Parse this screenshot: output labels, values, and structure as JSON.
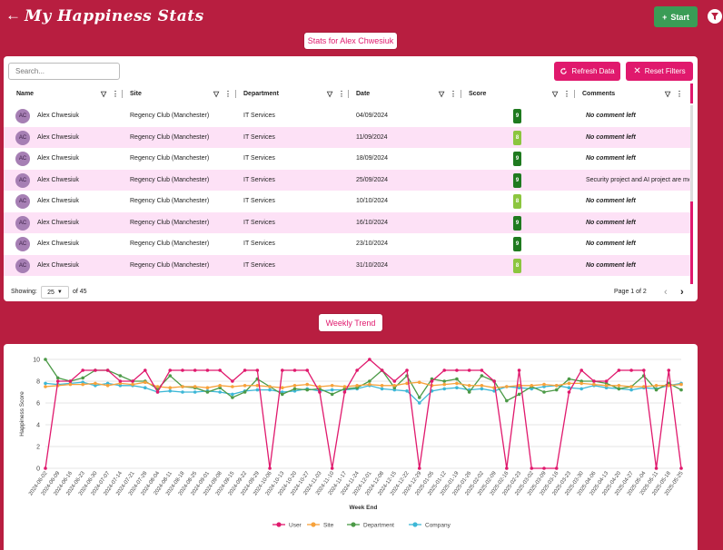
{
  "app": {
    "title": "My Happiness Stats",
    "back_icon": "arrow-left-icon"
  },
  "start_button": {
    "label": "Start",
    "icon": "plus-icon",
    "color": "#3a9c56"
  },
  "filter_button": {
    "icon": "funnel-icon"
  },
  "stats_pill": {
    "label": "Stats for Alex Chwesiuk"
  },
  "search": {
    "placeholder": "Search...",
    "value": ""
  },
  "buttons": {
    "refresh": "Refresh Data",
    "reset": "Reset Filters",
    "accent": "#e0196d"
  },
  "table": {
    "columns": [
      "Name",
      "Site",
      "Department",
      "Date",
      "Score",
      "Comments"
    ],
    "rows": [
      {
        "initials": "AC",
        "name": "Alex Chwesiuk",
        "site": "Regency Club (Manchester)",
        "department": "IT Services",
        "date": "04/09/2024",
        "score": "9",
        "comment": "No comment left"
      },
      {
        "initials": "AC",
        "name": "Alex Chwesiuk",
        "site": "Regency Club (Manchester)",
        "department": "IT Services",
        "date": "11/09/2024",
        "score": "8",
        "comment": "No comment left"
      },
      {
        "initials": "AC",
        "name": "Alex Chwesiuk",
        "site": "Regency Club (Manchester)",
        "department": "IT Services",
        "date": "18/09/2024",
        "score": "9",
        "comment": "No comment left"
      },
      {
        "initials": "AC",
        "name": "Alex Chwesiuk",
        "site": "Regency Club (Manchester)",
        "department": "IT Services",
        "date": "25/09/2024",
        "score": "9",
        "comment": "Security project and AI project are mo"
      },
      {
        "initials": "AC",
        "name": "Alex Chwesiuk",
        "site": "Regency Club (Manchester)",
        "department": "IT Services",
        "date": "10/10/2024",
        "score": "8",
        "comment": "No comment left"
      },
      {
        "initials": "AC",
        "name": "Alex Chwesiuk",
        "site": "Regency Club (Manchester)",
        "department": "IT Services",
        "date": "16/10/2024",
        "score": "9",
        "comment": "No comment left"
      },
      {
        "initials": "AC",
        "name": "Alex Chwesiuk",
        "site": "Regency Club (Manchester)",
        "department": "IT Services",
        "date": "23/10/2024",
        "score": "9",
        "comment": "No comment left"
      },
      {
        "initials": "AC",
        "name": "Alex Chwesiuk",
        "site": "Regency Club (Manchester)",
        "department": "IT Services",
        "date": "31/10/2024",
        "score": "8",
        "comment": "No comment left"
      }
    ],
    "score_colors": {
      "9": "#1f7a1f",
      "8": "#8cc63f"
    },
    "footer": {
      "showing_label": "Showing:",
      "page_size": "25",
      "of_label": "of 45",
      "page_label": "Page 1 of 2"
    }
  },
  "trend_pill": {
    "label": "Weekly Trend"
  },
  "chart_data": {
    "type": "line",
    "title": "",
    "xlabel": "Week End",
    "ylabel": "Happiness Score",
    "ylim": [
      0,
      10
    ],
    "yticks": [
      0,
      2,
      4,
      6,
      8,
      10
    ],
    "grid": "horizontal",
    "legend_position": "bottom",
    "x": [
      "2024-06-02",
      "2024-06-09",
      "2024-06-16",
      "2024-06-23",
      "2024-06-30",
      "2024-07-07",
      "2024-07-14",
      "2024-07-21",
      "2024-07-28",
      "2024-08-04",
      "2024-08-11",
      "2024-08-18",
      "2024-08-25",
      "2024-09-01",
      "2024-09-08",
      "2024-09-15",
      "2024-09-22",
      "2024-09-29",
      "2024-10-06",
      "2024-10-13",
      "2024-10-20",
      "2024-10-27",
      "2024-11-03",
      "2024-11-10",
      "2024-11-17",
      "2024-11-24",
      "2024-12-01",
      "2024-12-08",
      "2024-12-15",
      "2024-12-22",
      "2024-12-29",
      "2025-01-05",
      "2025-01-12",
      "2025-01-19",
      "2025-01-26",
      "2025-02-02",
      "2025-02-09",
      "2025-02-16",
      "2025-02-23",
      "2025-03-02",
      "2025-03-09",
      "2025-03-16",
      "2025-03-23",
      "2025-03-30",
      "2025-04-06",
      "2025-04-13",
      "2025-04-20",
      "2025-04-27",
      "2025-05-04",
      "2025-05-11",
      "2025-05-18",
      "2025-05-25"
    ],
    "series": [
      {
        "name": "User",
        "color": "#e0196d",
        "values": [
          0,
          8,
          8,
          9,
          9,
          9,
          8,
          8,
          9,
          7,
          9,
          9,
          9,
          9,
          9,
          8,
          9,
          9,
          0,
          9,
          9,
          9,
          7,
          0,
          7,
          9,
          10,
          9,
          8,
          9,
          0,
          8,
          9,
          9,
          9,
          9,
          8,
          0,
          9,
          0,
          0,
          0,
          7,
          9,
          8,
          8,
          9,
          9,
          9,
          0,
          9,
          0
        ]
      },
      {
        "name": "Site",
        "color": "#f7a23b",
        "values": [
          7.5,
          7.6,
          7.7,
          7.7,
          7.8,
          7.6,
          7.8,
          7.7,
          7.9,
          7.5,
          7.4,
          7.5,
          7.5,
          7.4,
          7.6,
          7.5,
          7.6,
          7.6,
          7.5,
          7.4,
          7.6,
          7.7,
          7.5,
          7.6,
          7.5,
          7.6,
          7.7,
          7.6,
          7.6,
          7.8,
          7.9,
          7.6,
          7.7,
          7.8,
          7.6,
          7.6,
          7.4,
          7.5,
          7.6,
          7.6,
          7.7,
          7.6,
          7.8,
          7.8,
          7.7,
          7.6,
          7.6,
          7.5,
          7.5,
          7.6,
          7.6,
          7.7
        ]
      },
      {
        "name": "Department",
        "color": "#4c9a47",
        "values": [
          10,
          8.3,
          8,
          8.3,
          9,
          9,
          8.5,
          8,
          8,
          7.3,
          8.5,
          7.5,
          7.4,
          7,
          7.4,
          6.5,
          7,
          8.2,
          7.5,
          6.8,
          7.3,
          7.2,
          7.3,
          6.8,
          7.3,
          7.4,
          8,
          9,
          7.4,
          8.5,
          6.5,
          8.2,
          8,
          8.2,
          7,
          8.5,
          8,
          6.2,
          6.8,
          7.5,
          7,
          7.2,
          8.2,
          8,
          8,
          7.8,
          7.3,
          7.5,
          8.5,
          7.2,
          7.8,
          7.2
        ]
      },
      {
        "name": "Company",
        "color": "#3db7d6",
        "values": [
          7.8,
          7.7,
          7.8,
          7.9,
          7.6,
          7.8,
          7.6,
          7.6,
          7.4,
          7,
          7.1,
          7,
          7,
          7.1,
          7,
          6.8,
          7.1,
          7.2,
          7.2,
          7,
          7.1,
          7.3,
          7.1,
          7.2,
          7.2,
          7.3,
          7.6,
          7.3,
          7.2,
          7.1,
          6,
          7.1,
          7.3,
          7.4,
          7.2,
          7.3,
          7.1,
          7.5,
          7.4,
          7.3,
          7.5,
          7.6,
          7.4,
          7.3,
          7.6,
          7.4,
          7.3,
          7.2,
          7.4,
          7.3,
          7.6,
          7.8
        ]
      }
    ]
  }
}
